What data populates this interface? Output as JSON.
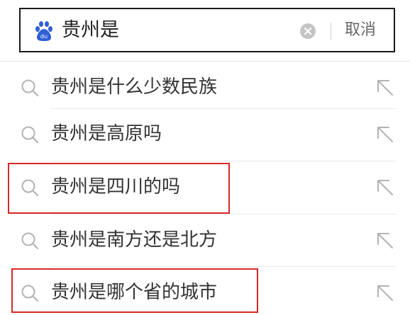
{
  "search": {
    "query": "贵州是",
    "logo_icon": "baidu-paw-icon",
    "clear_icon": "clear-circle-icon",
    "cancel_label": "取消"
  },
  "suggestions": [
    {
      "label": "贵州是什么少数民族",
      "highlighted": false
    },
    {
      "label": "贵州是高原吗",
      "highlighted": false
    },
    {
      "label": "贵州是四川的吗",
      "highlighted": true
    },
    {
      "label": "贵州是南方还是北方",
      "highlighted": false
    },
    {
      "label": "贵州是哪个省的城市",
      "highlighted": true
    }
  ],
  "icons": {
    "item_left": "search-icon",
    "item_right": "fill-arrow-icon"
  },
  "colors": {
    "highlight_border": "#d62828",
    "logo_blue": "#3060d8",
    "text": "#333333"
  }
}
